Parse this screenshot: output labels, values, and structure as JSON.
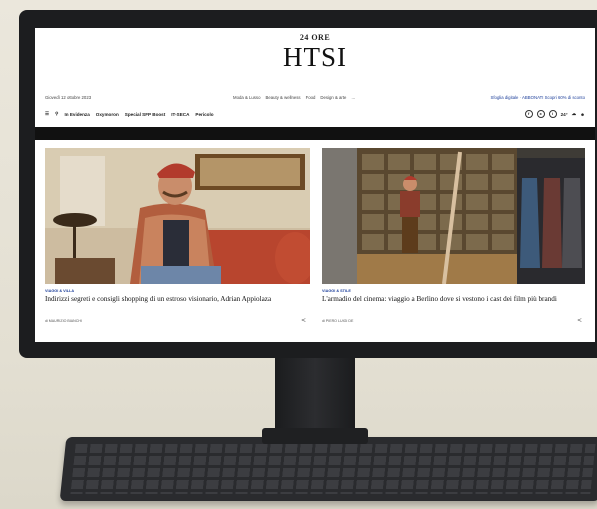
{
  "site": {
    "publisher": "24 ORE",
    "title": "HTSI",
    "date": "Giovedì 12 ottobre 2023",
    "sections": [
      "Moda & Lusso",
      "Beauty & wellness",
      "Food",
      "Design & arte",
      "..."
    ],
    "subscribe_cta": "Sfoglia digitale · ABBONATI Scopri 60% di sconto"
  },
  "nav": {
    "items": [
      "In Evidenza",
      "Oxymoron",
      "Special SFP Boost",
      "IT-SECA",
      "Pericolo"
    ],
    "temperature": "24°"
  },
  "articles": [
    {
      "tag": "VIAGGI & VILLA",
      "headline": "Indirizzi segreti e consigli shopping di un estroso visionario, Adrian Appiolaza",
      "author": "di MAURIZIO BIANCHI"
    },
    {
      "tag": "VIAGGI & STILE",
      "headline": "L'armadio del cinema: viaggio a Berlino dove si vestono i cast dei film più brandi",
      "author": "di PIERO LUIGI DE"
    }
  ]
}
